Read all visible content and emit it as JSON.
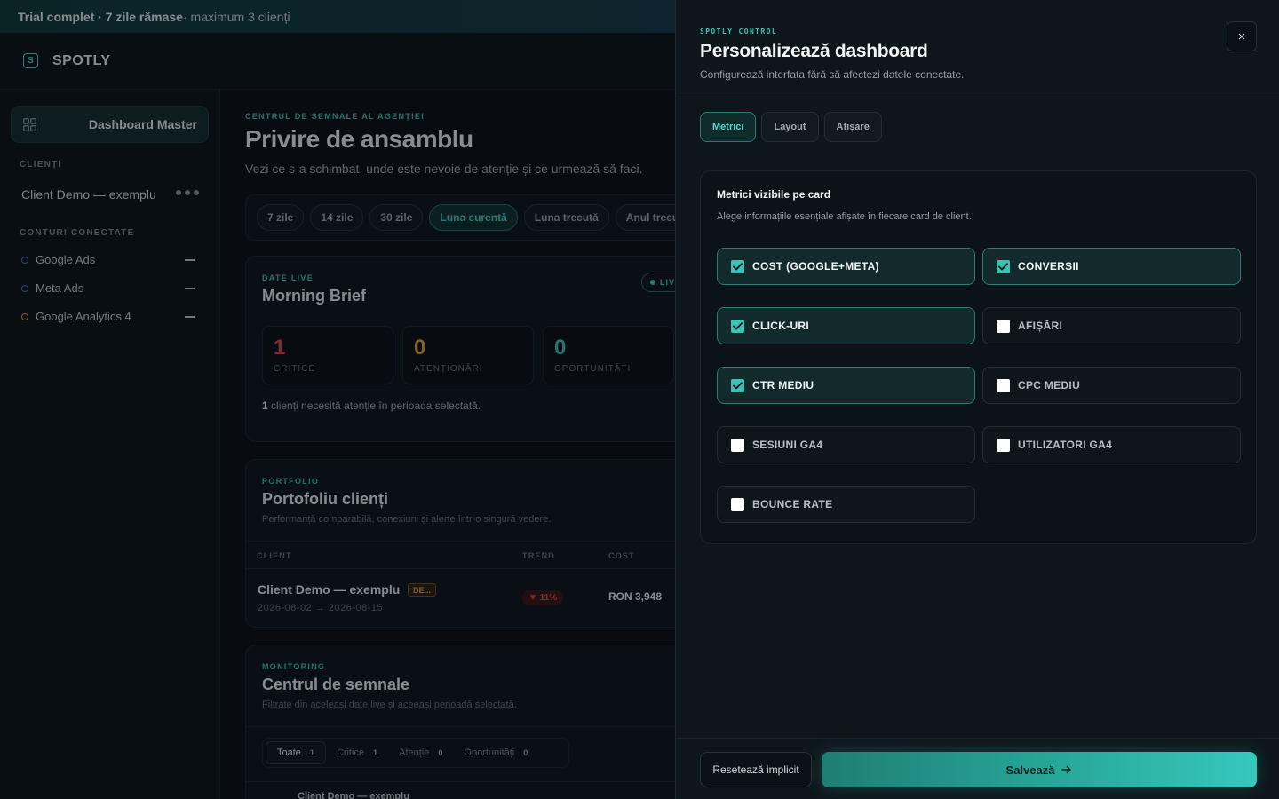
{
  "trial_bar": {
    "bold": "Trial complet · 7 zile rămase",
    "rest": " · maximum 3 clienți"
  },
  "brand": {
    "name": "SPOTLY",
    "mark": "S"
  },
  "sidebar": {
    "active_item": "Dashboard Master",
    "clients_heading": "CLIENȚI",
    "client_name": "Client Demo — exemplu",
    "accounts_heading": "CONTURI CONECTATE",
    "accounts": [
      {
        "label": "Google Ads",
        "color": "#3a7bd5"
      },
      {
        "label": "Meta Ads",
        "color": "#3a7bd5"
      },
      {
        "label": "Google Analytics 4",
        "color": "#e0a23a"
      }
    ]
  },
  "main": {
    "eyebrow": "CENTRUL DE SEMNALE AL AGENȚIEI",
    "title": "Privire de ansamblu",
    "subtitle": "Vezi ce s-a schimbat, unde este nevoie de atenție și ce urmează să faci.",
    "periods": [
      "7 zile",
      "14 zile",
      "30 zile",
      "Luna curentă",
      "Luna trecută",
      "Anul trecut"
    ],
    "active_period": "Luna curentă",
    "brief": {
      "eyebrow": "DATE LIVE",
      "title": "Morning Brief",
      "live": "LIVE",
      "stats": [
        {
          "value": "1",
          "label": "CRITICE",
          "color": "#e0464a"
        },
        {
          "value": "0",
          "label": "ATENȚIONĂRI",
          "color": "#e0a23a"
        },
        {
          "value": "0",
          "label": "OPORTUNITĂȚI",
          "color": "#3fc2b4"
        }
      ],
      "note_bold": "1",
      "note_rest": " clienți necesită atenție în perioada selectată."
    },
    "portfolio": {
      "eyebrow": "PORTFOLIO",
      "title": "Portofoliu clienți",
      "subtitle": "Performanță comparabilă, conexiuni și alerte într-o singură vedere.",
      "columns": [
        "CLIENT",
        "TREND",
        "COST"
      ],
      "row": {
        "client": "Client Demo — exemplu",
        "badge": "DE...",
        "dates": "2026-08-02 → 2026-08-15",
        "trend": "▼ 11%",
        "cost": "RON 3,948"
      }
    },
    "monitoring": {
      "eyebrow": "MONITORING",
      "title": "Centrul de semnale",
      "subtitle": "Filtrate din aceleași date live și aceeași perioadă selectată.",
      "filters": [
        {
          "label": "Toate",
          "count": "1"
        },
        {
          "label": "Critice",
          "count": "1"
        },
        {
          "label": "Atenție",
          "count": "0"
        },
        {
          "label": "Oportunități",
          "count": "0"
        }
      ],
      "peek_row": "Client Demo — exemplu"
    }
  },
  "drawer": {
    "eyebrow": "SPOTLY CONTROL",
    "title": "Personalizează dashboard",
    "subtitle": "Configurează interfața fără să afectezi datele conectate.",
    "close_icon": "×",
    "tabs": [
      "Metrici",
      "Layout",
      "Afișare"
    ],
    "active_tab": "Metrici",
    "panel_title": "Metrici vizibile pe card",
    "panel_subtitle": "Alege informațiile esențiale afișate în fiecare card de client.",
    "metrics": [
      {
        "label": "COST (GOOGLE+META)",
        "checked": true
      },
      {
        "label": "CONVERSII",
        "checked": true
      },
      {
        "label": "CLICK-URI",
        "checked": true
      },
      {
        "label": "AFIȘĂRI",
        "checked": false
      },
      {
        "label": "CTR MEDIU",
        "checked": true
      },
      {
        "label": "CPC MEDIU",
        "checked": false
      },
      {
        "label": "SESIUNI GA4",
        "checked": false
      },
      {
        "label": "UTILIZATORI GA4",
        "checked": false
      },
      {
        "label": "BOUNCE RATE",
        "checked": false
      }
    ],
    "reset_label": "Resetează implicit",
    "save_label": "Salvează",
    "save_icon": "arrow-right-icon"
  },
  "colors": {
    "accent": "#3bc2b3",
    "critical": "#e0464a",
    "warning": "#e0a23a"
  }
}
